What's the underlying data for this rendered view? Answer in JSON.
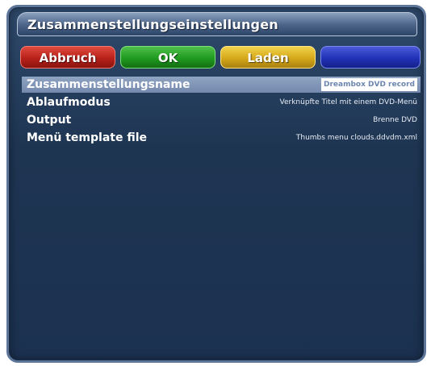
{
  "window": {
    "title": "Zusammenstellungseinstellungen"
  },
  "buttons": {
    "red_label": "Abbruch",
    "green_label": "OK",
    "yellow_label": "Laden",
    "blue_label": ""
  },
  "settings": [
    {
      "label": "Zusammenstellungsname",
      "value": "Dreambox DVD record",
      "selected": true
    },
    {
      "label": "Ablaufmodus",
      "value": "Verknüpfte Titel mit einem DVD-Menü",
      "selected": false
    },
    {
      "label": "Output",
      "value": "Brenne DVD",
      "selected": false
    },
    {
      "label": "Menü template file",
      "value": "Thumbs menu clouds.ddvdm.xml",
      "selected": false
    }
  ],
  "colors": {
    "red": "#b8201a",
    "green": "#1f9a1f",
    "yellow": "#d4a81a",
    "blue": "#2232b8",
    "background": "#1e3552"
  }
}
